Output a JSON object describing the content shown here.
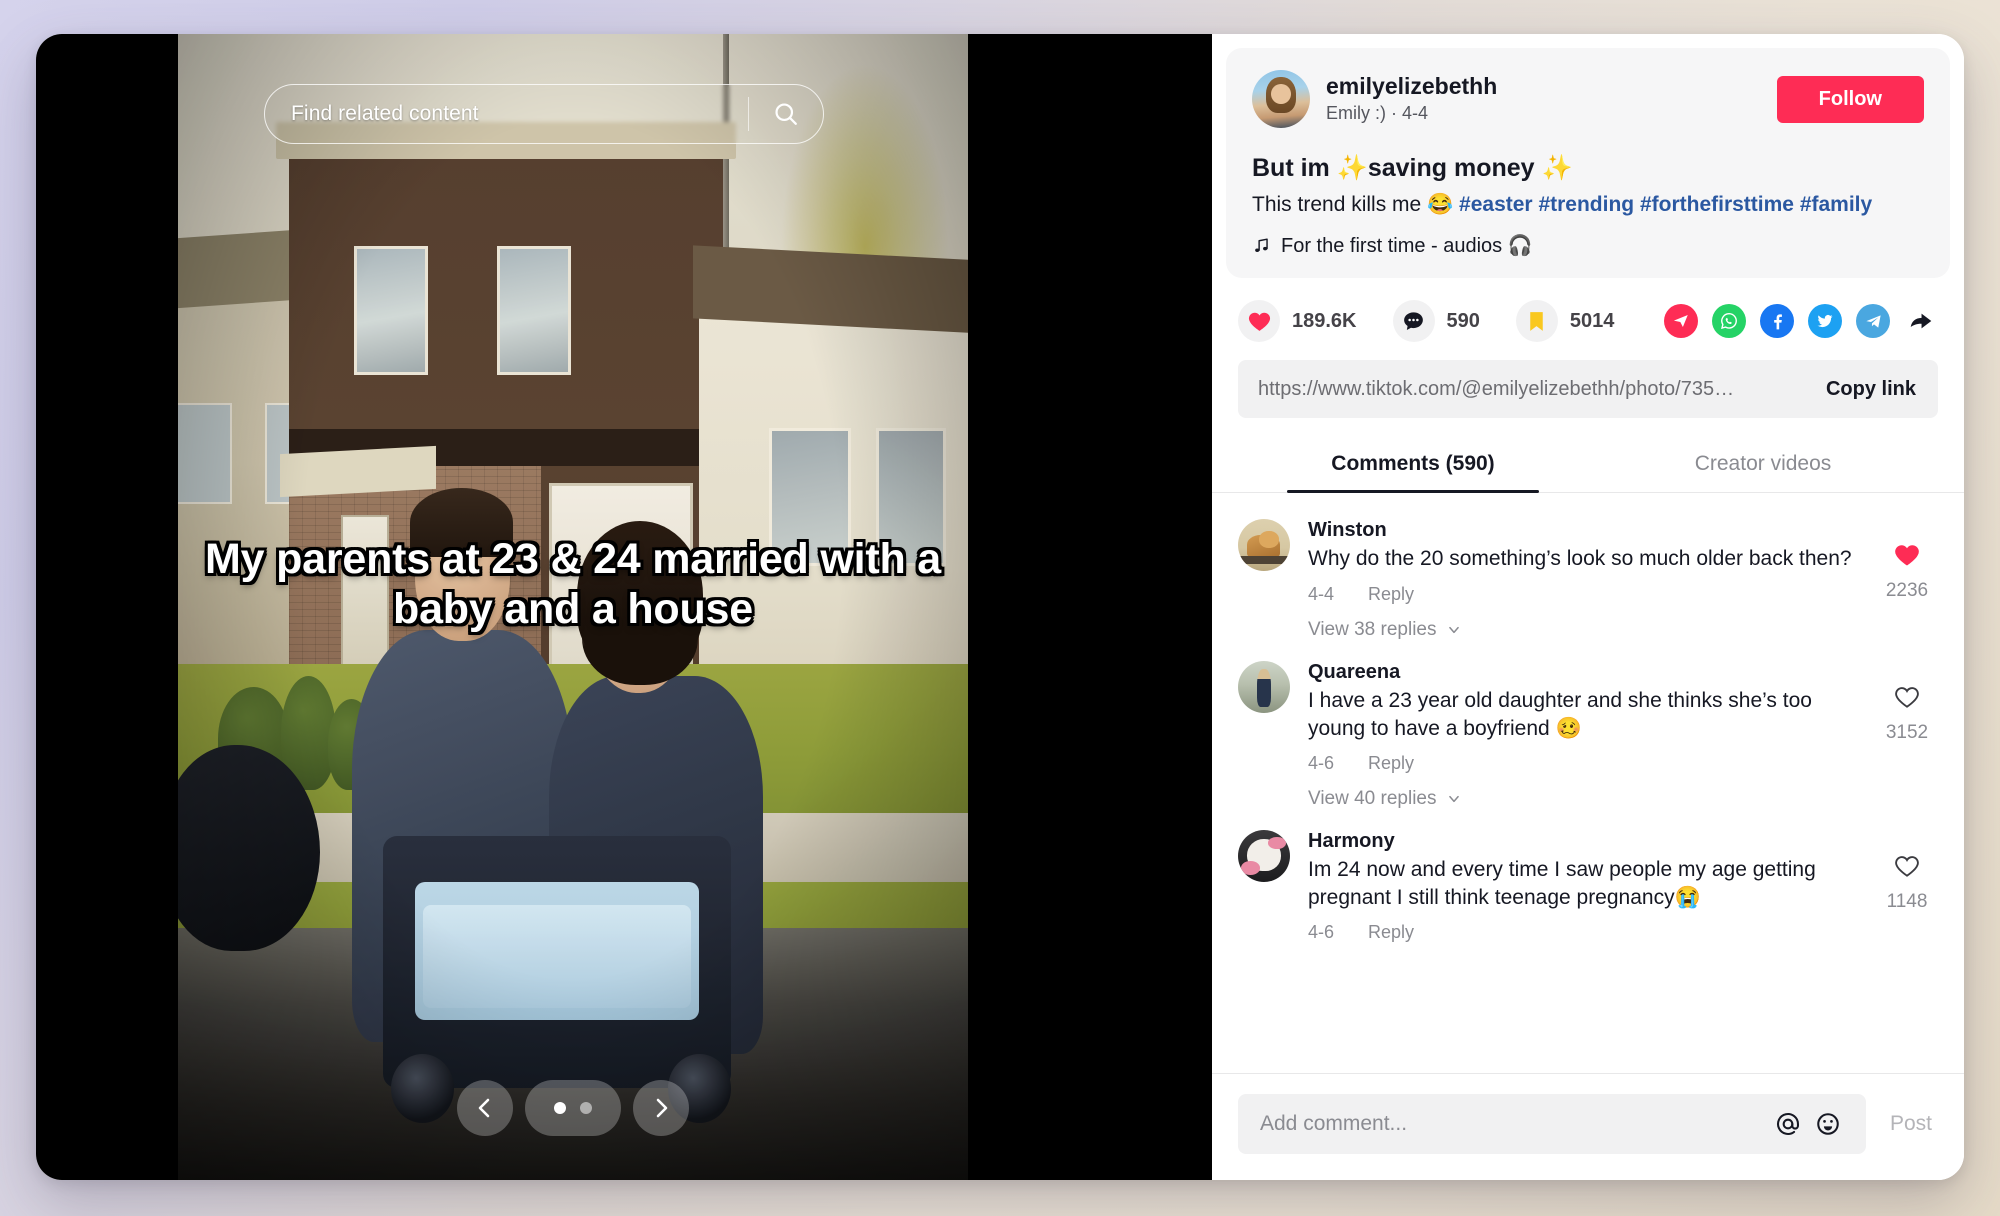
{
  "video": {
    "search_placeholder": "Find related content",
    "search_icon": "search-icon",
    "caption": "My parents at 23 & 24 married with a baby and a house",
    "carousel": {
      "prev_icon": "chevron-left-icon",
      "next_icon": "chevron-right-icon",
      "slide_count": 2,
      "active_slide": 1
    }
  },
  "post": {
    "author_handle": "emilyelizebethh",
    "author_subtitle": "Emily :) · 4-4",
    "follow_label": "Follow",
    "title": "But im ✨saving money ✨",
    "description_text": "This trend kills me 😂 ",
    "hashtags": [
      "#easter",
      "#trending",
      "#forthefirsttime",
      "#family"
    ],
    "music_icon": "music-note-icon",
    "music_label": "For the first time - audios 🎧"
  },
  "stats": {
    "like": {
      "icon": "heart-icon",
      "count": "189.6K"
    },
    "comment": {
      "icon": "comment-bubble-icon",
      "count": "590"
    },
    "bookmark": {
      "icon": "bookmark-icon",
      "count": "5014"
    },
    "share_icons": [
      "telegram-red-icon",
      "whatsapp-icon",
      "facebook-icon",
      "twitter-icon",
      "telegram-icon",
      "share-arrow-icon"
    ]
  },
  "share": {
    "url": "https://www.tiktok.com/@emilyelizebethh/photo/735…",
    "copy_label": "Copy link"
  },
  "tabs": [
    {
      "label": "Comments (590)",
      "active": true
    },
    {
      "label": "Creator videos",
      "active": false
    }
  ],
  "comments": [
    {
      "avatar": "av-winston",
      "name": "Winston",
      "text": "Why do the 20 something’s look so much older back then?",
      "date": "4-4",
      "reply_label": "Reply",
      "view_replies": "View 38 replies",
      "liked": true,
      "like_count": "2236"
    },
    {
      "avatar": "av-quareena",
      "name": "Quareena",
      "text": "I have a 23 year old daughter and she thinks she’s too young to have a boyfriend 🥴",
      "date": "4-6",
      "reply_label": "Reply",
      "view_replies": "View 40 replies",
      "liked": false,
      "like_count": "3152"
    },
    {
      "avatar": "av-harmony",
      "name": "Harmony",
      "text": "Im 24 now and every time I saw people my age getting pregnant I still think teenage pregnancy😭",
      "date": "4-6",
      "reply_label": "Reply",
      "view_replies": "",
      "liked": false,
      "like_count": "1148"
    }
  ],
  "add_comment": {
    "placeholder": "Add comment...",
    "mention_icon": "at-mention-icon",
    "emoji_icon": "emoji-icon",
    "post_label": "Post"
  },
  "colors": {
    "brand_red": "#fe2c55",
    "like_red": "#fe2c55",
    "bookmark_yellow": "#f9c81f",
    "link_blue": "#2b58a1",
    "text_primary": "#161823",
    "text_muted": "#8a8b91"
  }
}
